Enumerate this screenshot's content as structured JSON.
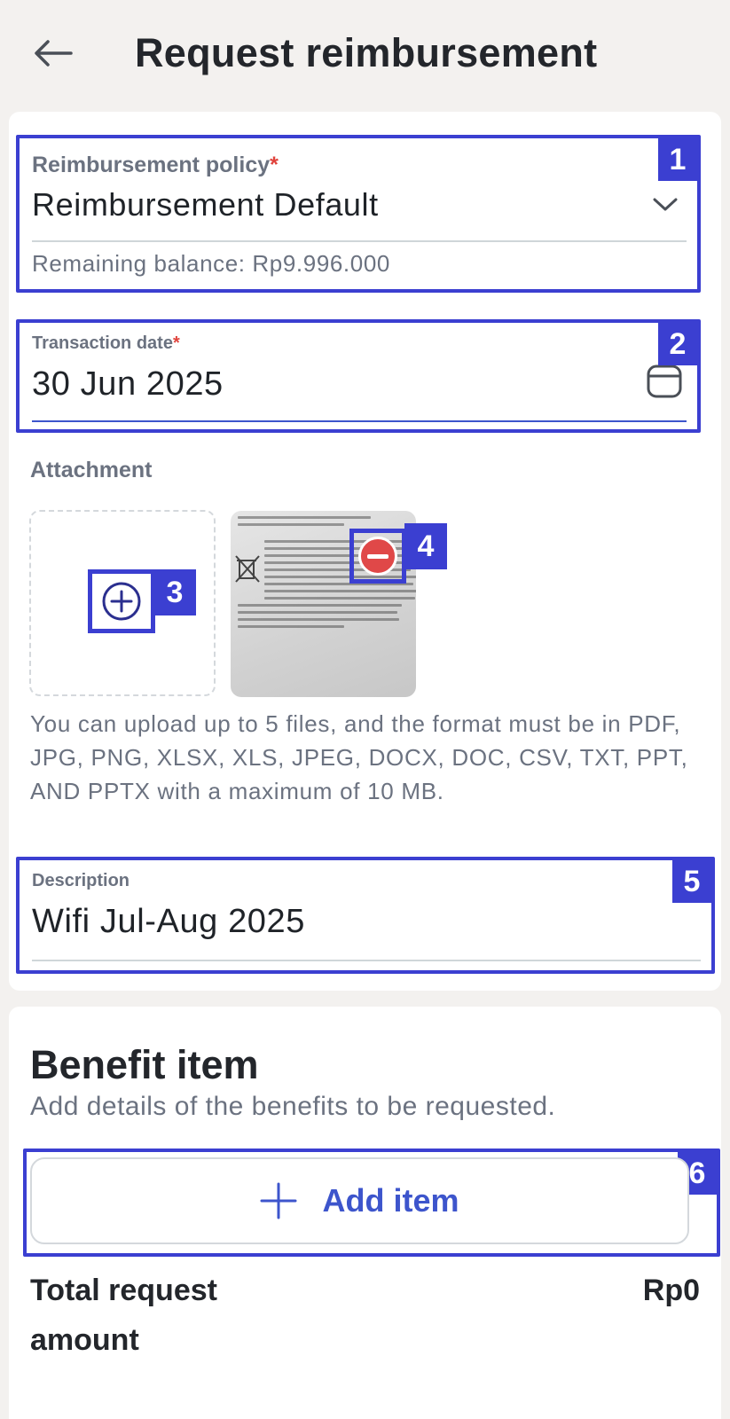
{
  "header": {
    "title": "Request reimbursement",
    "back_icon": "arrow-left-icon"
  },
  "form": {
    "policy": {
      "label": "Reimbursement policy",
      "required_mark": "*",
      "value": "Reimbursement Default",
      "balance": "Remaining balance: Rp9.996.000",
      "badge": "1"
    },
    "transaction_date": {
      "label": "Transaction date",
      "required_mark": "*",
      "value": "30 Jun 2025",
      "badge": "2"
    },
    "attachment": {
      "label": "Attachment",
      "add_badge": "3",
      "remove_badge": "4",
      "hint": "You can upload up to 5 files, and the format must be in PDF, JPG, PNG, XLSX, XLS, JPEG, DOCX, DOC, CSV, TXT, PPT, AND PPTX with a maximum of 10 MB."
    },
    "description": {
      "label": "Description",
      "value": "Wifi Jul-Aug 2025",
      "badge": "5"
    }
  },
  "benefit": {
    "title": "Benefit item",
    "subtitle": "Add details of the benefits to be requested.",
    "add_item_label": "Add item",
    "add_badge": "6",
    "total_label": "Total request amount",
    "total_value": "Rp0"
  },
  "colors": {
    "highlight": "#3b3fd1",
    "accent": "#3d55cc",
    "required": "#e0433c",
    "remove": "#e04848",
    "background": "#f3f1ef"
  }
}
